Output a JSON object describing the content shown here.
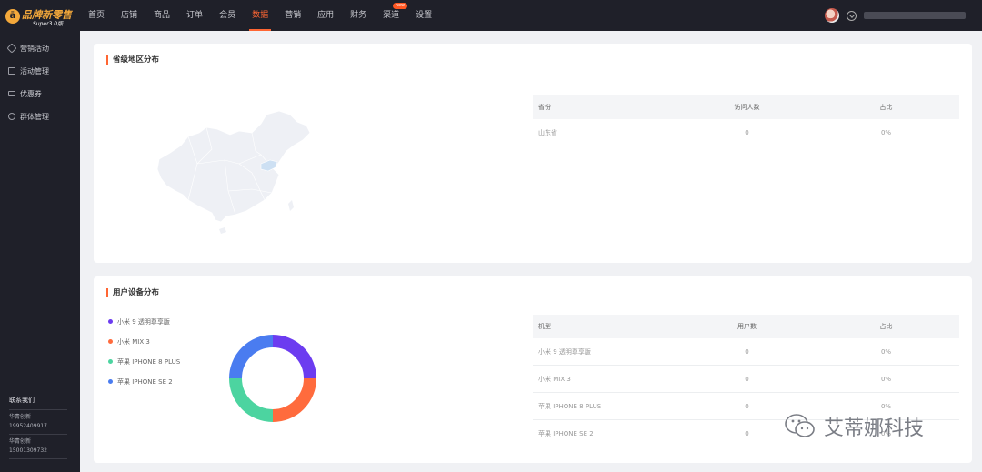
{
  "app": {
    "logo_title": "品牌新零售",
    "logo_sub": "Super3.0版"
  },
  "nav": {
    "items": [
      "首页",
      "店铺",
      "商品",
      "订单",
      "会员",
      "数据",
      "营销",
      "应用",
      "财务",
      "渠道",
      "设置"
    ],
    "active": "数据",
    "badge": "new"
  },
  "sidebar": {
    "items": [
      "营销活动",
      "活动管理",
      "优惠券",
      "群体管理"
    ],
    "contact_title": "联系我们",
    "contacts": [
      {
        "name": "华青创新",
        "phone": "19952409917"
      },
      {
        "name": "华青创新",
        "phone": "15001309732"
      }
    ]
  },
  "region": {
    "title": "省级地区分布",
    "columns": [
      "省份",
      "访问人数",
      "占比"
    ],
    "rows": [
      [
        "山东省",
        "0",
        "0%"
      ]
    ]
  },
  "device": {
    "title": "用户设备分布",
    "columns": [
      "机型",
      "用户数",
      "占比"
    ],
    "rows": [
      [
        "小米 9 透明尊享版",
        "0",
        "0%"
      ],
      [
        "小米 MIX 3",
        "0",
        "0%"
      ],
      [
        "苹果 IPHONE 8 PLUS",
        "0",
        "0%"
      ],
      [
        "苹果 IPHONE SE 2",
        "0",
        "0%"
      ]
    ]
  },
  "chart_data": {
    "type": "pie",
    "categories": [
      "小米 9 透明尊享版",
      "小米 MIX 3",
      "苹果 IPHONE 8 PLUS",
      "苹果 IPHONE SE 2"
    ],
    "values": [
      0,
      0,
      0,
      0
    ],
    "colors": [
      "#6c3cf0",
      "#ff6b3d",
      "#4cd4a0",
      "#4a7cf0"
    ],
    "legend": "left"
  },
  "watermark": "艾蒂娜科技",
  "colors": {
    "accent": "#ff6633",
    "nav_bg": "#1f2029",
    "map_fill": "#eef0f5",
    "map_highlight": "#cde0f3"
  }
}
